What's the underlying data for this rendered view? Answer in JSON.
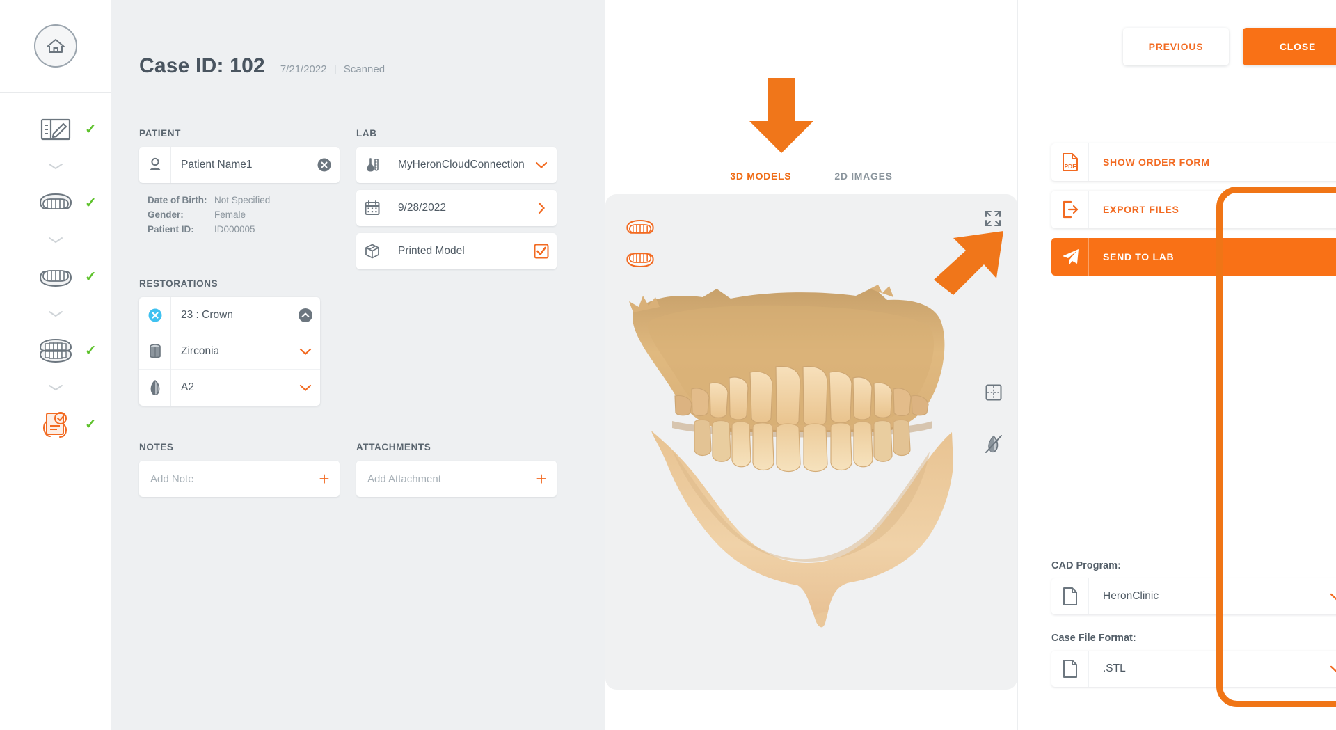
{
  "sidebar": {
    "home_icon": "home-icon",
    "steps": [
      {
        "icon": "form-edit-icon",
        "name": "order-form-step",
        "checked": true,
        "check": "✓"
      },
      {
        "icon": "upper-arch-icon",
        "name": "upper-scan-step",
        "checked": true,
        "check": "✓"
      },
      {
        "icon": "lower-arch-icon",
        "name": "lower-scan-step",
        "checked": true,
        "check": "✓"
      },
      {
        "icon": "bite-arch-icon",
        "name": "bite-scan-step",
        "checked": true,
        "check": "✓"
      },
      {
        "icon": "review-send-icon",
        "name": "review-send-step",
        "checked": true,
        "check": "✓"
      }
    ]
  },
  "case": {
    "title": "Case ID: 102",
    "date": "7/21/2022",
    "separator": "|",
    "status": "Scanned"
  },
  "patient": {
    "section_label": "PATIENT",
    "name_value": "Patient Name1",
    "name_icon": "person-icon",
    "clear_icon": "clear-circle-icon",
    "details": [
      {
        "key": "Date of Birth:",
        "value": "Not Specified"
      },
      {
        "key": "Gender:",
        "value": "Female"
      },
      {
        "key": "Patient ID:",
        "value": "ID000005"
      }
    ]
  },
  "lab": {
    "section_label": "LAB",
    "rows": [
      {
        "name": "lab-connection-row",
        "icon": "flask-icon",
        "value": "MyHeronCloudConnection",
        "action": "chevron-down-icon"
      },
      {
        "name": "due-date-row",
        "icon": "calendar-icon",
        "value": "9/28/2022",
        "action": "chevron-right-icon"
      },
      {
        "name": "printed-model-row",
        "icon": "cube-icon",
        "value": "Printed Model",
        "action": "checkbox-checked-icon"
      }
    ]
  },
  "restorations": {
    "section_label": "RESTORATIONS",
    "rows": [
      {
        "name": "restoration-tooth-row",
        "icon": "remove-circle-icon",
        "value": "23 : Crown",
        "action": "chevron-up-icon"
      },
      {
        "name": "restoration-material-row",
        "icon": "material-cylinder-icon",
        "value": "Zirconia",
        "action": "chevron-down-icon"
      },
      {
        "name": "restoration-shade-row",
        "icon": "shade-icon",
        "value": "A2",
        "action": "chevron-down-icon"
      }
    ]
  },
  "notes": {
    "section_label": "NOTES",
    "placeholder": "Add Note",
    "add_icon": "plus-icon"
  },
  "attachments": {
    "section_label": "ATTACHMENTS",
    "placeholder": "Add Attachment",
    "add_icon": "plus-icon"
  },
  "viewer": {
    "tabs": [
      {
        "label": "3D MODELS",
        "active": true,
        "name": "tab-3d-models"
      },
      {
        "label": "2D IMAGES",
        "active": false,
        "name": "tab-2d-images"
      }
    ],
    "expand_icon": "fullscreen-expand-icon",
    "mini_icons": [
      "upper-arch-thumb-icon",
      "lower-arch-thumb-icon"
    ],
    "side_tools": [
      "sectioning-grid-icon",
      "hide-shading-icon"
    ],
    "model_alt": "dental-arch-3d-model"
  },
  "annotations": {
    "arrow_down": "orange-arrow-down",
    "arrow_up_right": "orange-arrow-up-right",
    "highlight_box": "orange-highlight-rectangle",
    "color": "#f07516"
  },
  "right": {
    "previous_label": "PREVIOUS",
    "close_label": "CLOSE",
    "actions": [
      {
        "label": "SHOW ORDER FORM",
        "icon": "pdf-file-icon",
        "name": "show-order-form-button",
        "primary": false
      },
      {
        "label": "EXPORT FILES",
        "icon": "export-icon",
        "name": "export-files-button",
        "primary": false
      },
      {
        "label": "SEND TO LAB",
        "icon": "send-plane-icon",
        "name": "send-to-lab-button",
        "primary": true
      }
    ],
    "cad_program_label": "CAD Program:",
    "cad_program_value": "HeronClinic",
    "case_file_format_label": "Case File Format:",
    "case_file_format_value": ".STL",
    "file_icon": "document-icon",
    "chevron_icon": "chevron-down-icon"
  },
  "theme": {
    "accent": "#f26a21",
    "accent_solid": "#f97116",
    "check_green": "#5ec22c",
    "text_dark": "#4a5560",
    "text_muted": "#8f9aa3",
    "panel_bg": "#eef0f2"
  }
}
